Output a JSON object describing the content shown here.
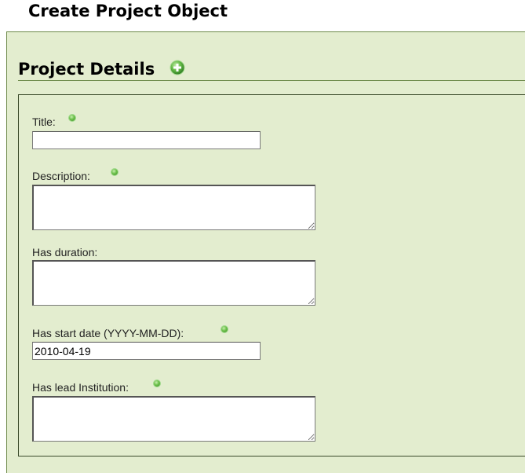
{
  "page": {
    "title": "Create Project Object"
  },
  "section": {
    "title": "Project Details",
    "add_icon": "add-circle-icon"
  },
  "fields": {
    "title": {
      "label": "Title:",
      "value": ""
    },
    "description": {
      "label": "Description:",
      "value": ""
    },
    "duration": {
      "label": "Has duration:",
      "value": ""
    },
    "start_date": {
      "label": "Has start date (YYYY-MM-DD):",
      "value": "2010-04-19"
    },
    "lead_institution": {
      "label": "Has lead Institution:",
      "value": ""
    }
  },
  "icons": {
    "help": "help-dot-icon",
    "resize": "resize-grip-icon"
  },
  "colors": {
    "panel_bg": "#e3edcf",
    "panel_border": "#6d8a4a",
    "icon_green": "#5cb83c"
  }
}
